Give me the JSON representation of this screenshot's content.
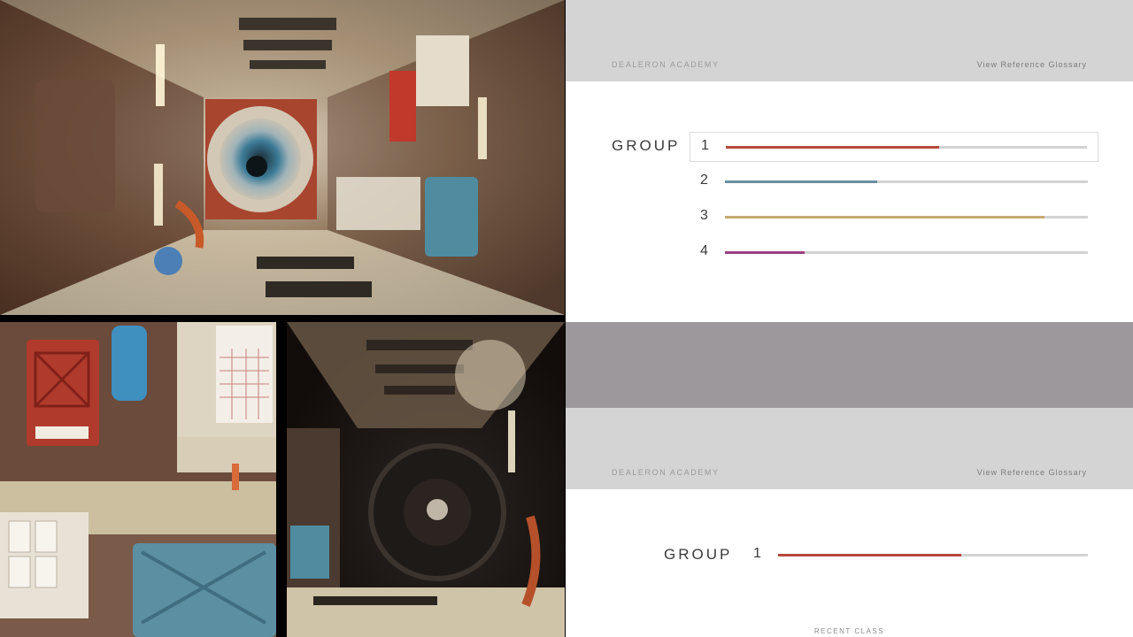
{
  "header": {
    "brand": "DEALERON ACADEMY",
    "glossary_link": "View Reference Glossary"
  },
  "group_panel": {
    "label": "GROUP",
    "selected_index": 0,
    "groups": [
      {
        "number": "1",
        "progress": 0.59,
        "color": "#b5483d"
      },
      {
        "number": "2",
        "progress": 0.42,
        "color": "#6b8fa2"
      },
      {
        "number": "3",
        "progress": 0.88,
        "color": "#c8a971"
      },
      {
        "number": "4",
        "progress": 0.22,
        "color": "#9c3f80"
      }
    ]
  },
  "group_panel_b": {
    "label": "GROUP",
    "groups": [
      {
        "number": "1",
        "progress": 0.59,
        "color": "#b5483d"
      }
    ],
    "recent_label": "RECENT CLASS"
  },
  "colors": {
    "header_bg": "#d4d4d4",
    "divider_band": "#9c989b",
    "track": "#d3d3d3"
  }
}
